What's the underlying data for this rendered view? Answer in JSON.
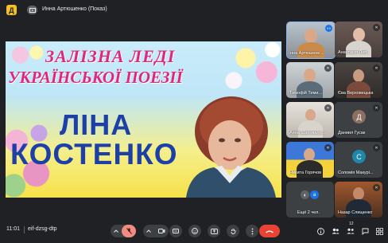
{
  "header": {
    "app_logo_letter": "Д",
    "presenter_icon": "presentation-icon",
    "presenter_name": "Инна Артюшенко (Показ)"
  },
  "slide": {
    "title_line_1": "ЗАЛІЗНА ЛЕДІ",
    "title_line_2": "УКРАЇНСЬКОЇ ПОЕЗІЇ",
    "name_line_1": "ЛІНА",
    "name_line_2": "КОСТЕНКО"
  },
  "participants": [
    {
      "label": "нна Артюшенк...",
      "state": "speaking"
    },
    {
      "label": "Анастасія Лип...",
      "state": "muted"
    },
    {
      "label": "Тимофій Тими...",
      "state": "muted"
    },
    {
      "label": "Єва Верховецька",
      "state": "muted"
    },
    {
      "label": "Анна Шаповало...",
      "state": "muted"
    },
    {
      "label": "Даниил Гусак",
      "avatar": "Д",
      "avatar_color": "#8d6e63",
      "state": "muted"
    },
    {
      "label": "Никита Горячов",
      "state": "muted"
    },
    {
      "label": "Соломія Макурі...",
      "avatar": "С",
      "avatar_color": "#1e88a8",
      "state": "muted"
    },
    {
      "label": "Ещё 2 чел.",
      "avatar": "а",
      "avatar_color": "#1a73e8"
    },
    {
      "label": "Назар Слищенко",
      "state": "muted"
    }
  ],
  "footer": {
    "time": "11:01",
    "meeting_code": "eif-dzsg-dtp",
    "participant_count": "12"
  },
  "colors": {
    "background": "#202124",
    "end_call": "#ea4335",
    "mic_off": "#f28b82",
    "accent": "#1a73e8"
  }
}
